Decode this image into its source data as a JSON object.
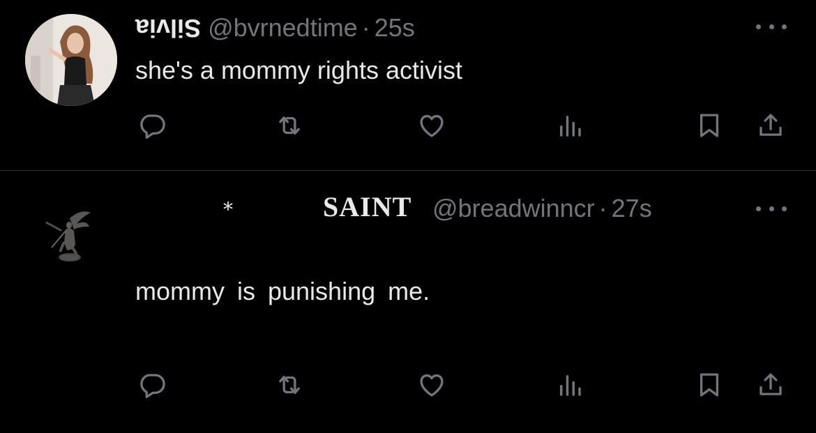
{
  "theme": {
    "background": "#000000",
    "text": "#e7e9ea",
    "muted": "#71767b",
    "divider": "#2f3336"
  },
  "tweets": [
    {
      "display_name": "Silvia",
      "handle": "@bvrnedtime",
      "separator": "·",
      "time": "25s",
      "text": "she's a mommy rights activist",
      "avatar_icon": "profile-photo-icon"
    },
    {
      "name_prefix": "*",
      "display_name": "SAINT",
      "handle": "@breadwinncr",
      "separator": "·",
      "time": "27s",
      "text": "mommy is punishing me.",
      "avatar_icon": "angel-statue-icon"
    }
  ],
  "action_icons": [
    "reply-icon",
    "retweet-icon",
    "like-icon",
    "views-icon",
    "bookmark-icon",
    "share-icon"
  ]
}
